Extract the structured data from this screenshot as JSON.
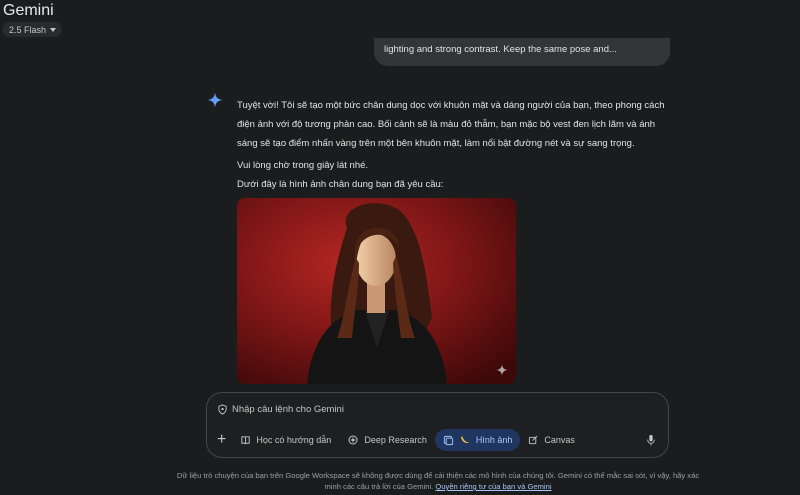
{
  "app": {
    "title": "Gemini",
    "model": "2.5 Flash"
  },
  "conversation": {
    "user_message": "lighting and strong contrast. Keep the same pose and...",
    "reply": {
      "paragraph1": "Tuyệt vời! Tôi sẽ tạo một bức chân dung dọc với khuôn mặt và dáng người của bạn, theo phong cách điện ảnh với độ tương phản cao. Bối cảnh sẽ là màu đỏ thẫm, bạn mặc bộ vest đen lịch lãm và ánh sáng sẽ tạo điểm nhấn vàng trên một bên khuôn mặt, làm nổi bật đường nét và sự sang trọng.",
      "line_wait": "Vui lòng chờ trong giây lát nhé.",
      "line_result": "Dưới đây là hình ảnh chân dung bạn đã yêu cầu:"
    }
  },
  "composer": {
    "placeholder": "Nhập câu lệnh cho Gemini",
    "tools": {
      "guided_learning": "Học có hướng dẫn",
      "deep_research": "Deep Research",
      "image": "Hình ảnh",
      "canvas": "Canvas"
    }
  },
  "footer": {
    "disclaimer": "Dữ liệu trò chuyện của bạn trên Google Workspace sẽ không được dùng để cải thiện các mô hình của chúng tôi. Gemini có thể mắc sai sót, vì vậy, hãy xác minh các câu trả lời của Gemini.",
    "privacy_link": "Quyền riêng tư của bạn và Gemini"
  },
  "colors": {
    "accent_blue": "#a8c7fa",
    "active_chip_bg": "#1f3760",
    "image_banana": "#f6c344",
    "backdrop_red": "#8b1818"
  },
  "icons": [
    "location-shield-icon",
    "plus-icon",
    "book-icon",
    "deep-research-icon",
    "image-icon",
    "banana-icon",
    "canvas-icon",
    "mic-icon",
    "sparkle-icon"
  ]
}
